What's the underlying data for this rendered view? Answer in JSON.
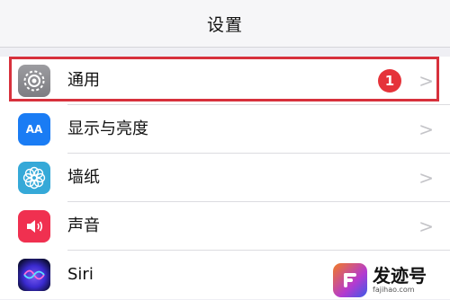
{
  "navbar": {
    "title": "设置"
  },
  "settings": {
    "items": [
      {
        "label": "通用",
        "icon": "gear-icon",
        "badge": "1",
        "chevron": ">"
      },
      {
        "label": "显示与亮度",
        "icon": "display-brightness-icon",
        "icon_text": "AA",
        "chevron": ">"
      },
      {
        "label": "墙纸",
        "icon": "wallpaper-flower-icon",
        "chevron": ">"
      },
      {
        "label": "声音",
        "icon": "speaker-icon",
        "chevron": ">"
      },
      {
        "label": "Siri",
        "icon": "siri-icon"
      }
    ]
  },
  "watermark": {
    "name": "发迹号",
    "url": "fajihao.com"
  },
  "colors": {
    "highlight": "#d7313c",
    "badge": "#e5333a",
    "display_icon": "#1a7cf4",
    "wallpaper_icon": "#35a9d8",
    "sound_icon": "#f03050"
  }
}
